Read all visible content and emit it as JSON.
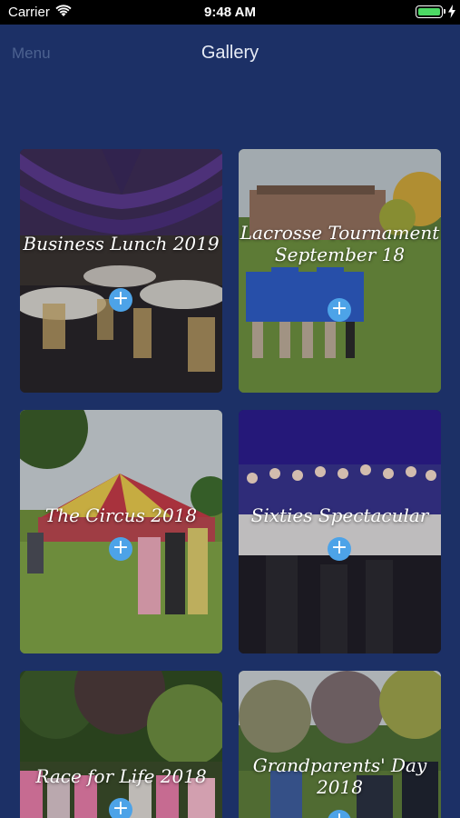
{
  "status": {
    "carrier": "Carrier",
    "time": "9:48 AM",
    "battery_level": 1.0
  },
  "nav": {
    "menu_label": "Menu",
    "title": "Gallery"
  },
  "albums": [
    {
      "title": "Business Lunch 2019"
    },
    {
      "title": "Lacrosse Tournament September 18"
    },
    {
      "title": "The Circus 2018"
    },
    {
      "title": "Sixties Spectacular"
    },
    {
      "title": "Race for Life 2018"
    },
    {
      "title": "Grandparents' Day 2018"
    }
  ],
  "add_icon": "+",
  "colors": {
    "background": "#1c3066",
    "accent": "#4da3e8",
    "battery": "#4cd964"
  }
}
